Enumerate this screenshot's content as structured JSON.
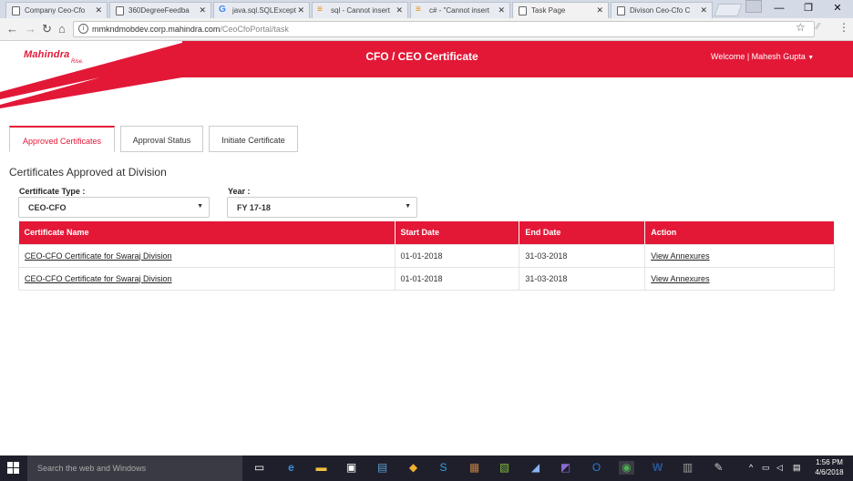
{
  "browser": {
    "tabs": [
      {
        "label": "Company Ceo-Cfo"
      },
      {
        "label": "360DegreeFeedba"
      },
      {
        "label": "java.sql.SQLExcept"
      },
      {
        "label": "sql - Cannot insert"
      },
      {
        "label": "c# - \"Cannot insert"
      },
      {
        "label": "Task Page"
      },
      {
        "label": "Divison Ceo-Cfo C"
      }
    ],
    "url_host": "mmkndmobdev.corp.mahindra.com",
    "url_path": "/CeoCfoPortal/task"
  },
  "header": {
    "brand": "Mahindra",
    "brand_sub": "Rise.",
    "title": "CFO / CEO Certificate",
    "welcome": "Welcome | Mahesh Gupta"
  },
  "tabs": [
    {
      "label": "Approved Certificates",
      "active": true
    },
    {
      "label": "Approval Status",
      "active": false
    },
    {
      "label": "Initiate Certificate",
      "active": false
    }
  ],
  "section_title": "Certificates Approved at Division",
  "filters": {
    "type_label": "Certificate Type :",
    "type_value": "CEO-CFO",
    "year_label": "Year :",
    "year_value": "FY 17-18"
  },
  "table": {
    "headers": [
      "Certificate Name",
      "Start Date",
      "End Date",
      "Action"
    ],
    "rows": [
      [
        "CEO-CFO Certificate for Swaraj Division",
        "01-01-2018",
        "31-03-2018",
        "View Annexures"
      ],
      [
        "CEO-CFO Certificate for Swaraj Division",
        "01-01-2018",
        "31-03-2018",
        "View Annexures"
      ]
    ]
  },
  "taskbar": {
    "search_placeholder": "Search the web and Windows",
    "time": "1:56 PM",
    "date": "4/6/2018"
  },
  "colors": {
    "brand_red": "#e31837"
  }
}
